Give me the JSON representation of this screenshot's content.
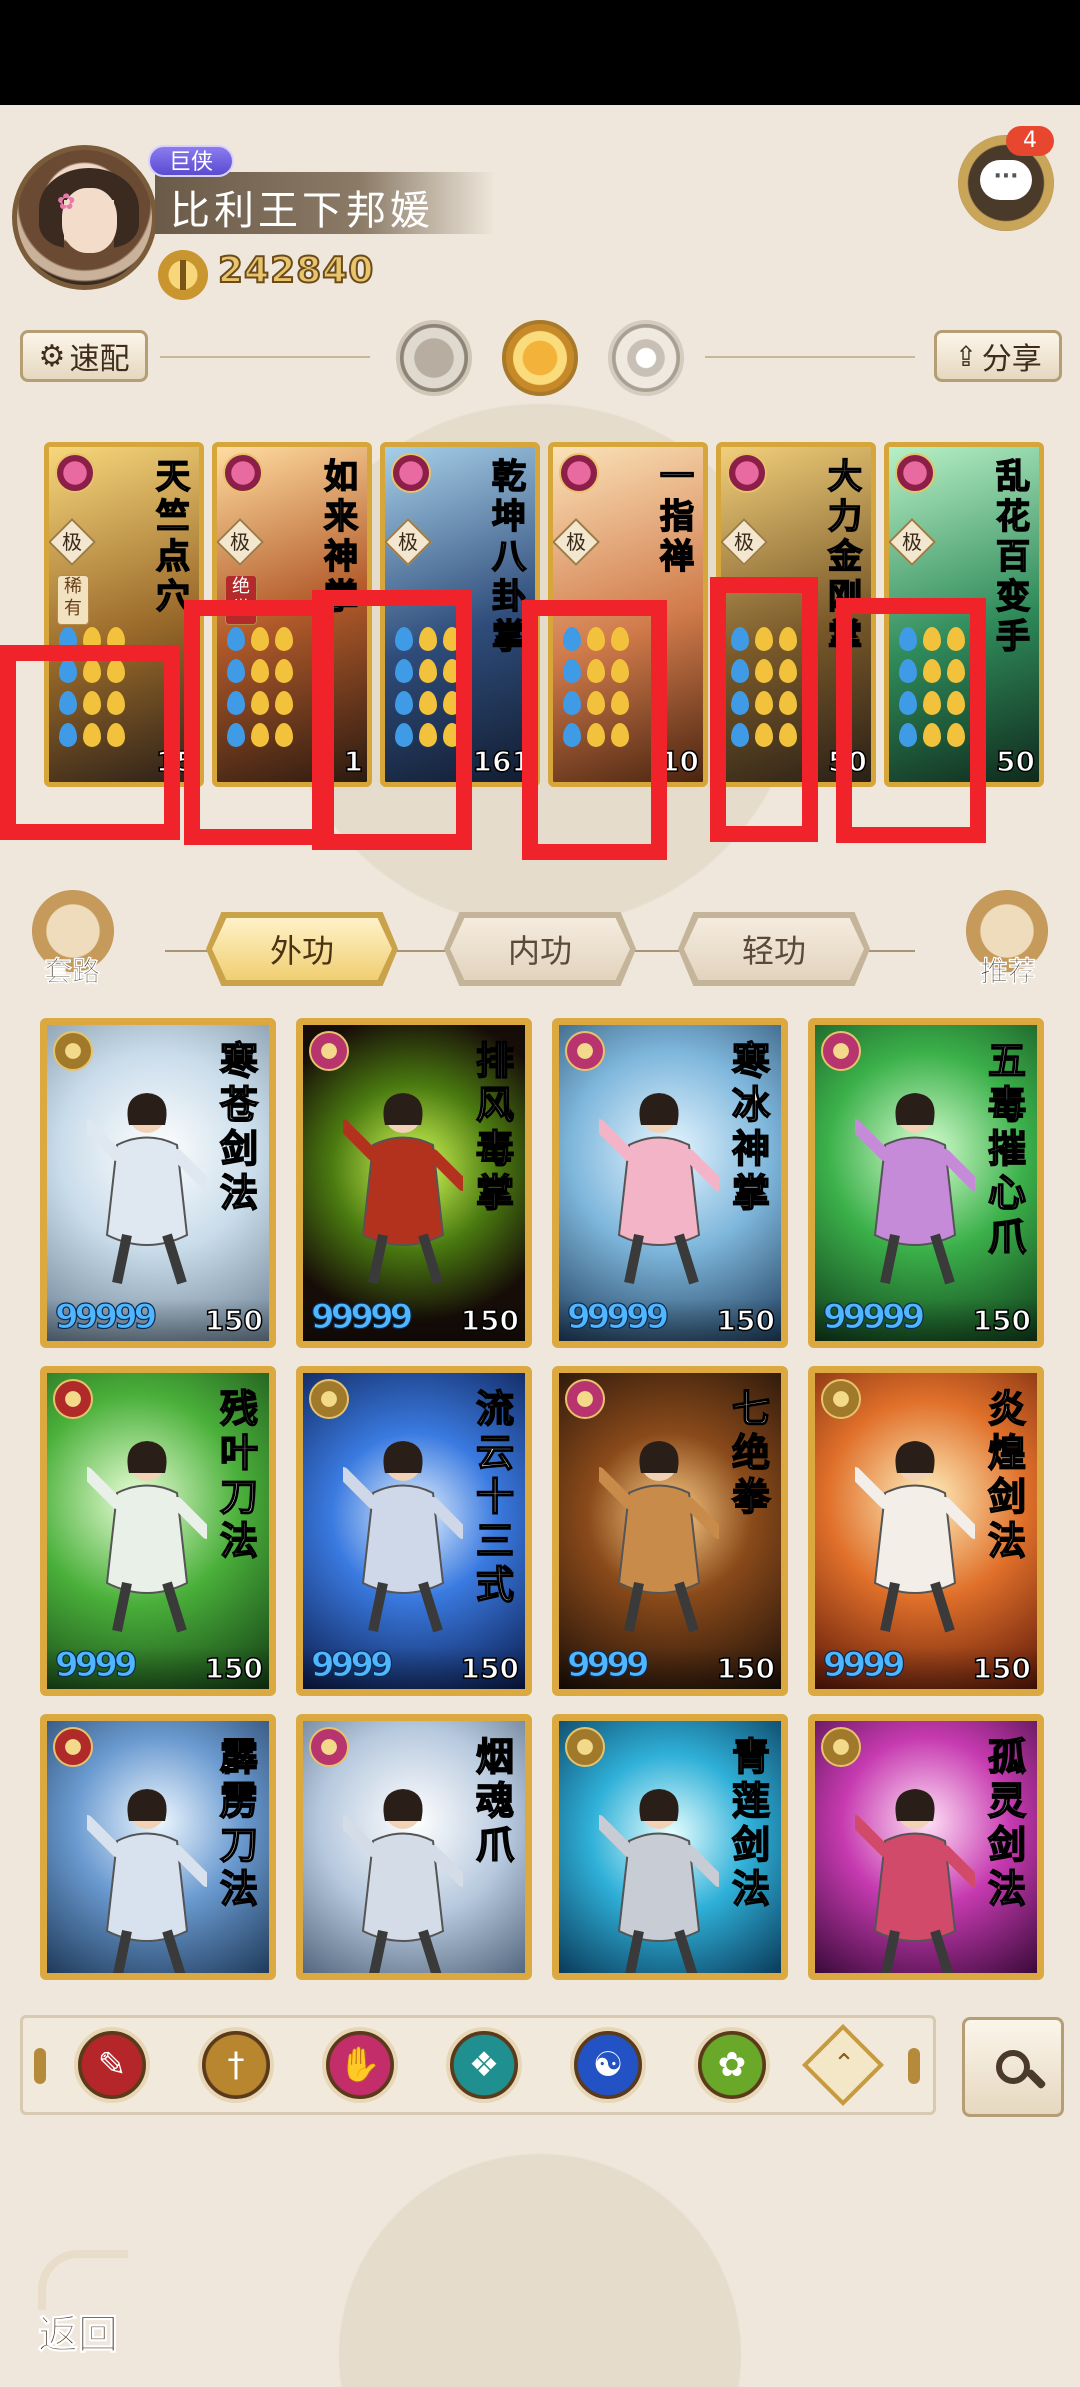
{
  "profile": {
    "rank": "巨侠",
    "name": "比利王下邦媛",
    "coins": "242840"
  },
  "chat": {
    "badge_count": "4",
    "icon": "chat-bubble-icon"
  },
  "toolbar": {
    "quick_match_label": "速配",
    "share_label": "分享",
    "modes": [
      "moon-icon",
      "sun-icon",
      "ring-icon"
    ]
  },
  "equipped": [
    {
      "name": "天竺点穴",
      "grade": "极",
      "rarity": "稀有",
      "level": "15"
    },
    {
      "name": "如来神掌",
      "grade": "极",
      "rarity": "绝世",
      "level": "1"
    },
    {
      "name": "乾坤八卦掌",
      "grade": "极",
      "rarity": "",
      "level": "161"
    },
    {
      "name": "一指禅",
      "grade": "极",
      "rarity": "",
      "level": "10"
    },
    {
      "name": "大力金刚掌",
      "grade": "极",
      "rarity": "",
      "level": "50"
    },
    {
      "name": "乱花百变手",
      "grade": "极",
      "rarity": "",
      "level": "50"
    }
  ],
  "tabs": {
    "left_button": "套路",
    "right_button": "推荐",
    "items": [
      "外功",
      "内功",
      "轻功"
    ]
  },
  "skills": [
    {
      "name": "寒苍剑法",
      "pips": "99999",
      "level": "150",
      "badge_color": "#a07a2a"
    },
    {
      "name": "排风毒掌",
      "pips": "99999",
      "level": "150",
      "badge_color": "#b8346e"
    },
    {
      "name": "寒冰神掌",
      "pips": "99999",
      "level": "150",
      "badge_color": "#b8346e"
    },
    {
      "name": "五毒摧心爪",
      "pips": "99999",
      "level": "150",
      "badge_color": "#b8346e"
    },
    {
      "name": "残叶刀法",
      "pips": "9999",
      "level": "150",
      "badge_color": "#b02a2a"
    },
    {
      "name": "流云十三式",
      "pips": "9999",
      "level": "150",
      "badge_color": "#a07a2a"
    },
    {
      "name": "七绝拳",
      "pips": "9999",
      "level": "150",
      "badge_color": "#b8346e"
    },
    {
      "name": "炎煌剑法",
      "pips": "9999",
      "level": "150",
      "badge_color": "#a07a2a"
    },
    {
      "name": "霹雳刀法",
      "pips": "",
      "level": "",
      "badge_color": "#b02a2a"
    },
    {
      "name": "烟魂爪",
      "pips": "",
      "level": "",
      "badge_color": "#b8346e"
    },
    {
      "name": "青莲剑法",
      "pips": "",
      "level": "",
      "badge_color": "#a07a2a"
    },
    {
      "name": "孤灵剑法",
      "pips": "",
      "level": "",
      "badge_color": "#a07a2a"
    }
  ],
  "filters": [
    {
      "icon": "blade-icon",
      "color": "#b5262b"
    },
    {
      "icon": "sword-icon",
      "color": "#b8862e"
    },
    {
      "icon": "palm-icon",
      "color": "#c22d6a"
    },
    {
      "icon": "fan-icon",
      "color": "#1f8f8f"
    },
    {
      "icon": "yin-yang-icon",
      "color": "#2352c4"
    },
    {
      "icon": "whip-icon",
      "color": "#6aa82a"
    },
    {
      "icon": "hidden-weapon-icon",
      "color": "#c69a3e"
    }
  ],
  "back_label": "返回"
}
